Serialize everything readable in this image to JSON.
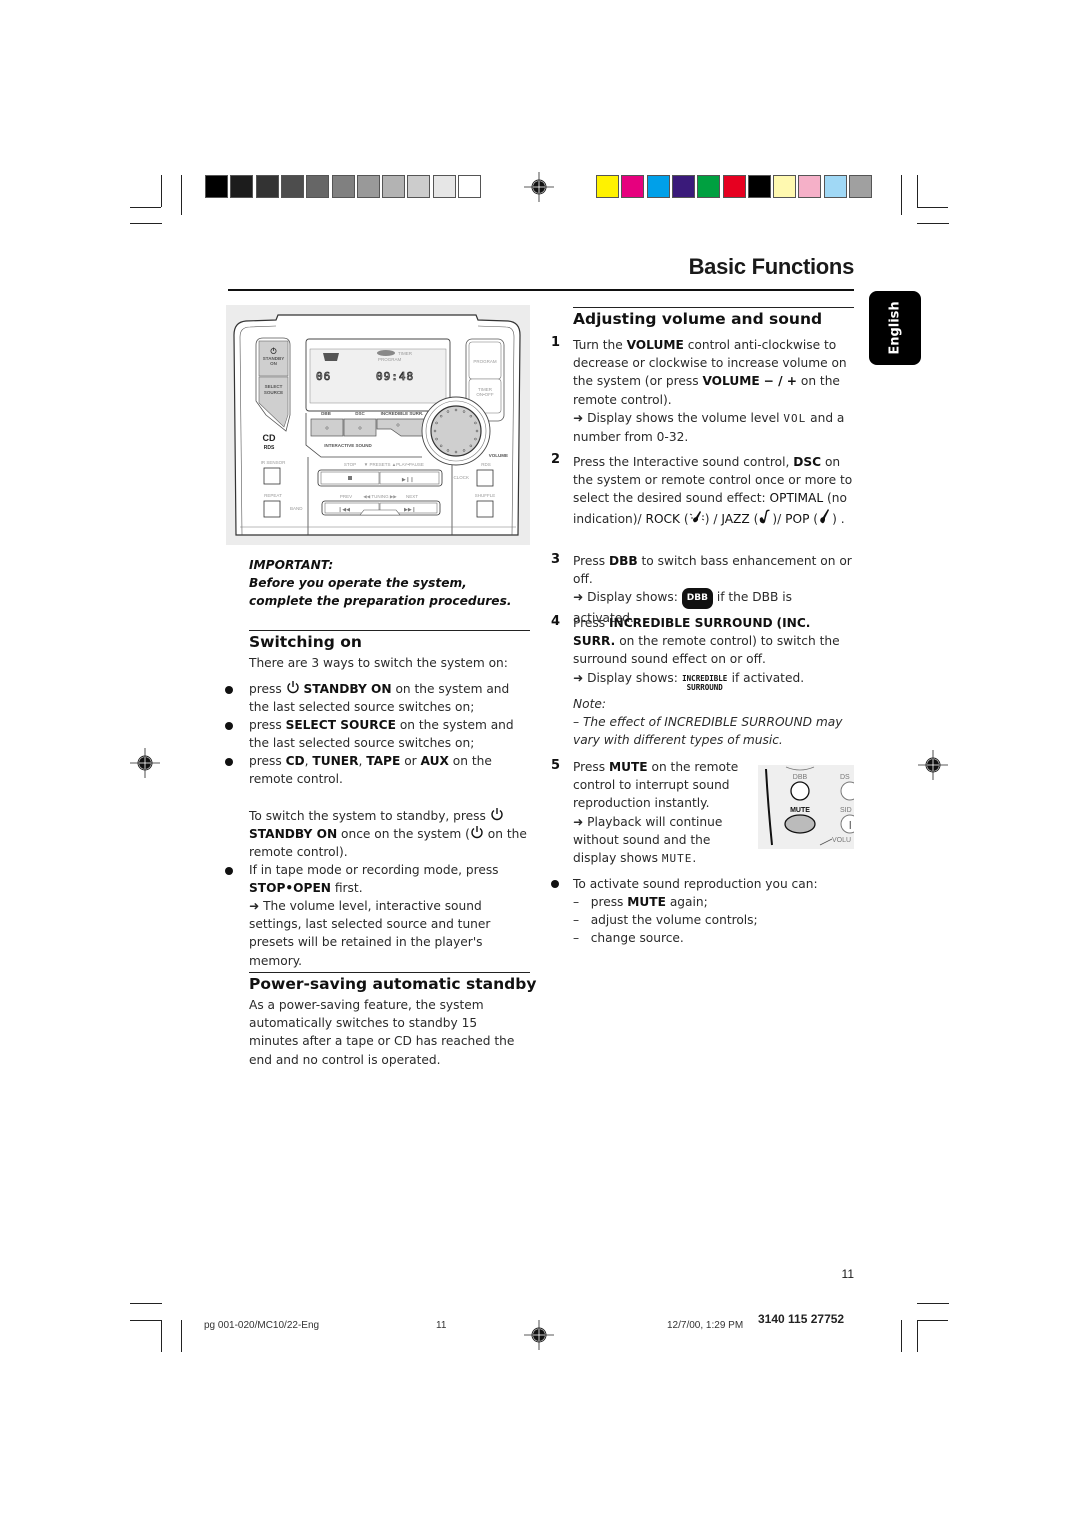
{
  "print_marks": {
    "gray_swatches": [
      "#000000",
      "#1c1c1c",
      "#333333",
      "#4d4d4d",
      "#666666",
      "#808080",
      "#999999",
      "#b3b3b3",
      "#cccccc",
      "#e6e6e6",
      "#ffffff"
    ],
    "color_swatches": [
      "#fff200",
      "#e6007e",
      "#00a0e9",
      "#3a1a7a",
      "#00a040",
      "#e60020",
      "#000000",
      "#fff9b0",
      "#f5b0c8",
      "#a0d8f5",
      "#a0a0a0"
    ]
  },
  "header": {
    "title": "Basic Functions",
    "language_tab": "English"
  },
  "device_panel": {
    "standby_label": "STANDBY ON",
    "select_source_label": "SELECT SOURCE",
    "program_label": "PROGRAM",
    "timer_label": "TIMER",
    "timer_sub": "ON•OFF",
    "display_track": "06",
    "display_time": "09:48",
    "display_timer": "TIMER",
    "display_program": "PROGRAM",
    "dbb_label": "DBB",
    "dsc_label": "DSC",
    "inc_surr_label": "INCREDIBLE SURR.",
    "interactive_sound_label": "INTERACTIVE SOUND",
    "volume_label": "VOLUME",
    "ir_sensor_label": "IR SENSOR",
    "stop_label": "STOP",
    "presets_label": "▼ PRESETS ▲",
    "play_pause_label": "PLAY•PAUSE",
    "rds_label": "RDS",
    "clock_label": "CLOCK",
    "repeat_label": "REPEAT",
    "band_label": "BAND",
    "prev_label": "PREV",
    "tuning_label": "◀◀ TUNING ▶▶",
    "next_label": "NEXT",
    "shuffle_label": "SHUFFLE",
    "cd_logo": "CD",
    "rds_logo": "RDS"
  },
  "important": {
    "heading": "IMPORTANT:",
    "text": "Before you operate the system, complete the preparation procedures."
  },
  "switching_on": {
    "heading": "Switching on",
    "intro": "There are 3 ways to switch the system on:",
    "bullets": [
      {
        "pre": "press",
        "bold": "STANDBY ON",
        "post": "on the system and the last selected source switches on;"
      },
      {
        "pre": "press",
        "bold": "SELECT SOURCE",
        "post": "on the system and the last selected source switches on;"
      },
      {
        "pre": "press",
        "bold1": "CD",
        "sep1": ",",
        "bold2": "TUNER",
        "sep2": ",",
        "bold3": "TAPE",
        "sep3": "or",
        "bold4": "AUX",
        "post": "on the remote control."
      }
    ],
    "standby_para": {
      "pre": "To switch the system to standby, press",
      "bold": "STANDBY ON",
      "mid": "once on the system (",
      "post": "on the remote control)."
    },
    "tape_bullet": {
      "pre": "If in tape mode or recording mode, press",
      "bold": "STOP•OPEN",
      "post": "first."
    },
    "memory_note": "The volume level, interactive sound settings, last selected source and tuner presets will be retained in the player's memory."
  },
  "power_saving": {
    "heading": "Power-saving automatic standby",
    "text": "As a power-saving feature, the system automatically switches to standby 15 minutes after a tape or CD has reached the end and no control is operated."
  },
  "adjusting": {
    "heading": "Adjusting volume and sound",
    "steps": [
      {
        "num": "1",
        "pre": "Turn the",
        "bold": "VOLUME",
        "mid": "control anti-clockwise to decrease or clockwise to increase volume on the system (or press",
        "bold2": "VOLUME",
        "symbols": "− / +",
        "post": "on the remote control).",
        "result_pre": "Display shows the volume level",
        "result_lcd": "VOL",
        "result_post": "and a number from 0-32."
      },
      {
        "num": "2",
        "pre": "Press the Interactive sound control,",
        "bold": "DSC",
        "mid": "on the system or remote control once or more to select the desired sound effect:",
        "opt1": "OPTIMAL",
        "opt1_note": "(no indication)/",
        "opt2": "ROCK",
        "opt3": "JAZZ",
        "opt4": "POP"
      },
      {
        "num": "3",
        "pre": "Press",
        "bold": "DBB",
        "post": "to switch bass enhancement on or off.",
        "result_pre": "Display shows:",
        "badge": "DBB",
        "result_post": "if the DBB is activated."
      },
      {
        "num": "4",
        "pre": "Press",
        "bold": "INCREDIBLE SURROUND",
        "bold2": "(INC. SURR.",
        "post": "on the remote control) to switch the surround sound effect on or off.",
        "result_pre": "Display shows:",
        "logo_top": "INCREDIBLE",
        "logo_bottom": "SURROUND",
        "result_post": "if activated."
      },
      {
        "num": "5",
        "pre": "Press",
        "bold": "MUTE",
        "post": "on the remote control to interrupt sound reproduction instantly.",
        "result_pre": "Playback will continue without sound and the display shows",
        "result_lcd": "MUTE",
        "result_end": "."
      }
    ],
    "note_label": "Note:",
    "note_text": "–  The effect of INCREDIBLE SURROUND may vary with different types of music.",
    "remote_inset": {
      "dbb": "DBB",
      "dsc": "DS",
      "mute": "MUTE",
      "side": "SID",
      "vol": "VOLU"
    },
    "activate": {
      "intro": "To activate sound reproduction you can:",
      "items": [
        {
          "pre": "press",
          "bold": "MUTE",
          "post": "again;"
        },
        {
          "text": "adjust the volume controls;"
        },
        {
          "text": "change source."
        }
      ]
    }
  },
  "footer": {
    "page_number": "11",
    "file_name": "pg 001-020/MC10/22-Eng",
    "file_page": "11",
    "timestamp": "12/7/00, 1:29 PM",
    "doc_code": "3140 115 27752"
  }
}
